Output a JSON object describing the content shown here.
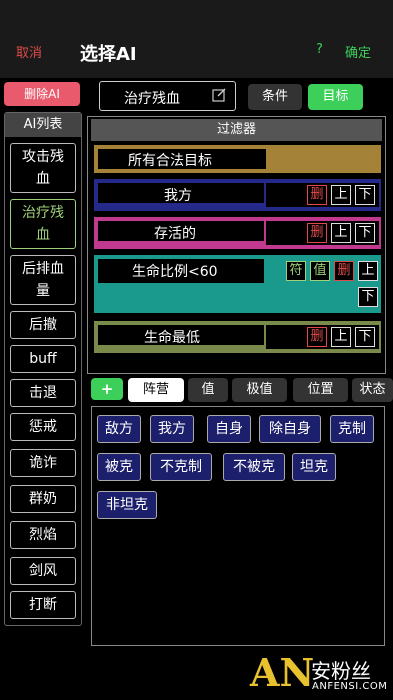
{
  "header": {
    "cancel": "取消",
    "title": "选择AI",
    "help": "?",
    "confirm": "确定"
  },
  "sidebar": {
    "delete_ai": "删除AI",
    "list_title": "AI列表",
    "items": [
      {
        "label": "攻击残血",
        "lines": [
          "攻击残",
          "血"
        ],
        "active": false
      },
      {
        "label": "治疗残血",
        "lines": [
          "治疗残",
          "血"
        ],
        "active": true
      },
      {
        "label": "后排血量",
        "lines": [
          "后排血",
          "量"
        ],
        "active": false
      },
      {
        "label": "后撤",
        "lines": [
          "后撤"
        ],
        "active": false
      },
      {
        "label": "buff",
        "lines": [
          "buff"
        ],
        "active": false
      },
      {
        "label": "击退",
        "lines": [
          "击退"
        ],
        "active": false
      },
      {
        "label": "惩戒",
        "lines": [
          "惩戒"
        ],
        "active": false
      },
      {
        "label": "诡诈",
        "lines": [
          "诡诈"
        ],
        "active": false
      },
      {
        "label": "群奶",
        "lines": [
          "群奶"
        ],
        "active": false
      },
      {
        "label": "烈焰",
        "lines": [
          "烈焰"
        ],
        "active": false
      },
      {
        "label": "剑风",
        "lines": [
          "剑风"
        ],
        "active": false
      },
      {
        "label": "打断",
        "lines": [
          "打断"
        ],
        "active": false
      }
    ]
  },
  "ai_name": "治疗残血",
  "tabs": {
    "condition": "条件",
    "target": "目标",
    "active": "目标"
  },
  "filter": {
    "title": "过滤器",
    "rows": [
      {
        "label": "所有合法目标",
        "color": "#a48238",
        "controls": []
      },
      {
        "label": "我方",
        "color": "#252a8a",
        "controls": [
          "删",
          "上",
          "下"
        ]
      },
      {
        "label": "存活的",
        "color": "#c0398f",
        "controls": [
          "删",
          "上",
          "下"
        ]
      },
      {
        "label": "生命比例<60",
        "color": "#1a9a8c",
        "controls": [
          "符",
          "值",
          "删",
          "上",
          "下"
        ]
      },
      {
        "label": "生命最低",
        "color": "#7a8a4a",
        "controls": [
          "删",
          "上",
          "下"
        ]
      }
    ]
  },
  "add_label": "+",
  "category_tabs": [
    "阵营",
    "值",
    "极值",
    "位置",
    "状态"
  ],
  "selected_category": "阵营",
  "chips": [
    "敌方",
    "我方",
    "自身",
    "除自身",
    "克制",
    "被克",
    "不克制",
    "不被克",
    "坦克",
    "非坦克"
  ],
  "watermark": {
    "logo": "AN",
    "cn": "安粉丝",
    "en": "ANFENSI.COM"
  }
}
